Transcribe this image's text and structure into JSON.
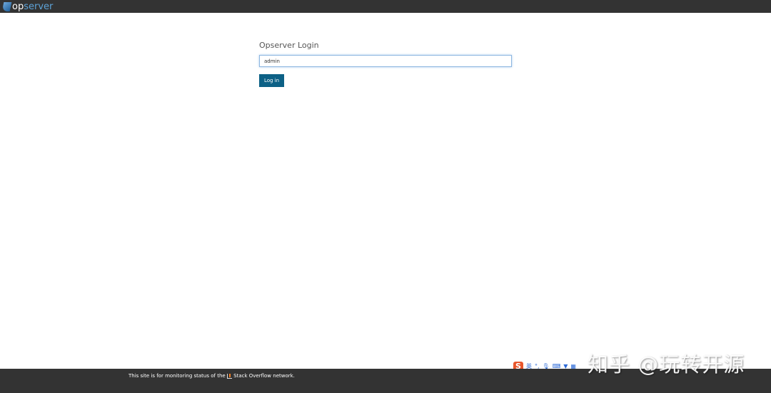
{
  "header": {
    "logo_prefix": "op",
    "logo_suffix": "server"
  },
  "login": {
    "title": "Opserver Login",
    "username_value": "admin",
    "submit_label": "Log in"
  },
  "footer": {
    "text_before": "This site is for monitoring status of the",
    "text_after": "Stack Overflow network."
  },
  "ime_toolbar": {
    "logo": "S",
    "mode": "英",
    "icons": [
      "punctuation-icon",
      "microphone-icon",
      "keyboard-icon",
      "skin-icon",
      "grid-menu-icon"
    ]
  },
  "watermark": "知乎 @玩转开源",
  "colors": {
    "header_bg": "#333333",
    "button_bg": "#0d6186",
    "logo_accent": "#5da3d8"
  }
}
